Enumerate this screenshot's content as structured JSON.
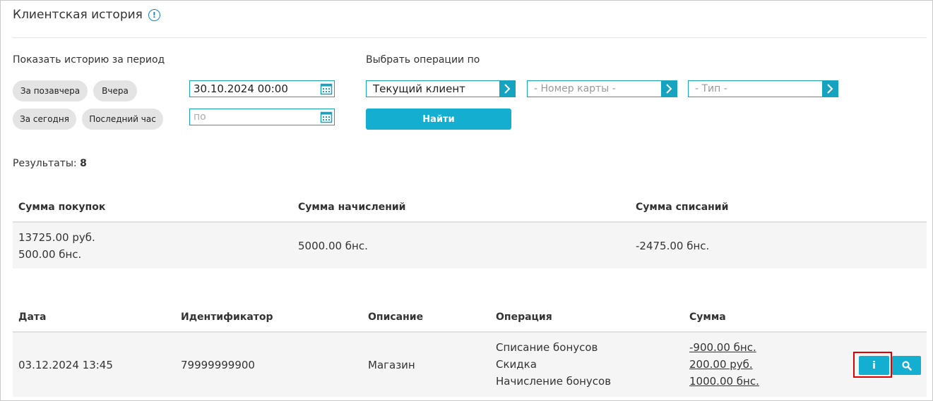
{
  "header": {
    "title": "Клиентская история",
    "info_icon": "info-circle-icon"
  },
  "period": {
    "label": "Показать историю за период",
    "chips": [
      "За позавчера",
      "Вчера",
      "За сегодня",
      "Последний час"
    ],
    "date_from": "30.10.2024 00:00",
    "date_to_placeholder": "по"
  },
  "operations": {
    "label": "Выбрать операции по",
    "client_select": "Текущий клиент",
    "card_select_placeholder": "- Номер карты -",
    "type_select_placeholder": "- Тип -",
    "find_button": "Найти"
  },
  "results": {
    "label": "Результаты:",
    "count": "8"
  },
  "summary": {
    "headers": [
      "Сумма покупок",
      "Сумма начислений",
      "Сумма списаний"
    ],
    "purchases_line1": "13725.00 руб.",
    "purchases_line2": "500.00 бнс.",
    "accruals": "5000.00 бнс.",
    "writeoffs": "-2475.00 бнс."
  },
  "history": {
    "headers": [
      "Дата",
      "Идентификатор",
      "Описание",
      "Операция",
      "Сумма"
    ],
    "rows": [
      {
        "date": "03.12.2024 13:45",
        "identifier": "79999999900",
        "description": "Магазин",
        "operations": [
          "Списание бонусов",
          "Скидка",
          "Начисление бонусов"
        ],
        "amounts": [
          "-900.00 бнс.",
          "200.00 руб.",
          "1000.00 бнс."
        ],
        "info_button": "i"
      }
    ]
  },
  "colors": {
    "accent": "#14aed0",
    "highlight": "#e00000"
  }
}
